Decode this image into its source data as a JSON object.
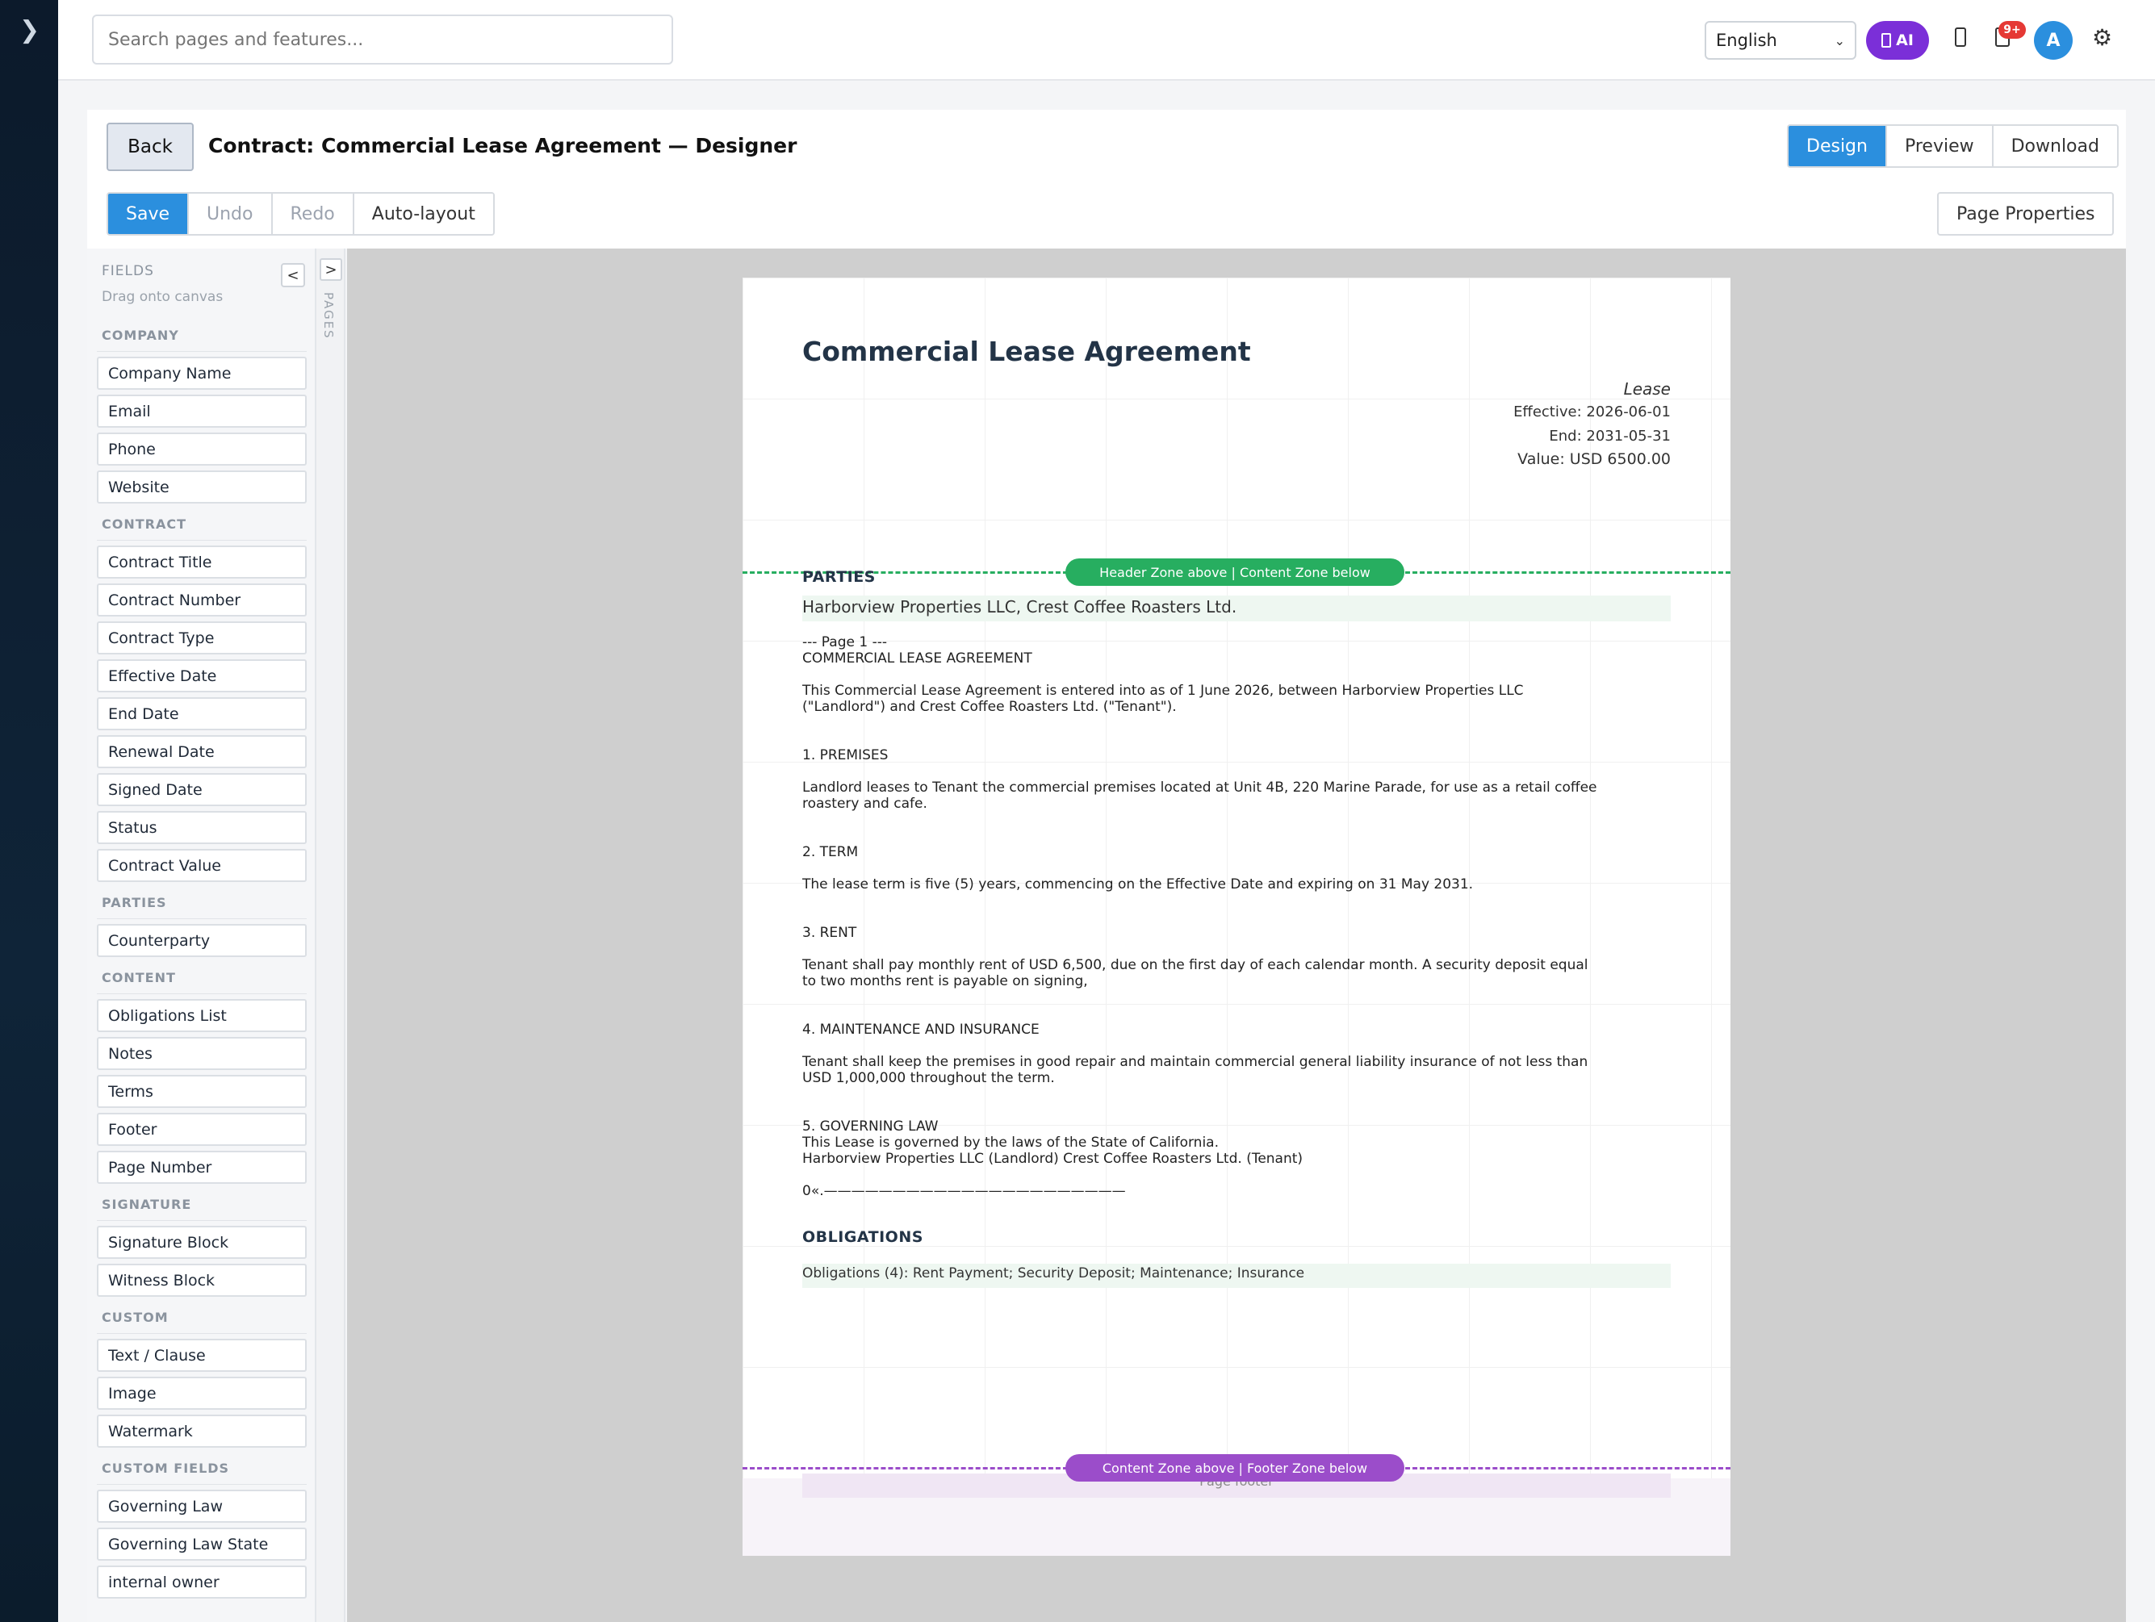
{
  "sidebar_toggle": "❯",
  "topbar": {
    "search_placeholder": "Search pages and features...",
    "language": "English",
    "ai_label": "AI",
    "notifications_badge": "9+",
    "avatar_initial": "A"
  },
  "header": {
    "back_label": "Back",
    "title": "Contract: Commercial Lease Agreement — Designer",
    "modes": [
      "Design",
      "Preview",
      "Download"
    ],
    "active_mode": "Design",
    "edit_actions": {
      "save": "Save",
      "undo": "Undo",
      "redo": "Redo",
      "auto_layout": "Auto-layout"
    },
    "page_properties": "Page Properties"
  },
  "fields_panel": {
    "heading": "FIELDS",
    "subheading": "Drag onto canvas",
    "collapse": "<",
    "groups": [
      {
        "name": "COMPANY",
        "items": [
          "Company Name",
          "Email",
          "Phone",
          "Website"
        ]
      },
      {
        "name": "CONTRACT",
        "items": [
          "Contract Title",
          "Contract Number",
          "Contract Type",
          "Effective Date",
          "End Date",
          "Renewal Date",
          "Signed Date",
          "Status",
          "Contract Value"
        ]
      },
      {
        "name": "PARTIES",
        "items": [
          "Counterparty"
        ]
      },
      {
        "name": "CONTENT",
        "items": [
          "Obligations List",
          "Notes",
          "Terms",
          "Footer",
          "Page Number"
        ]
      },
      {
        "name": "SIGNATURE",
        "items": [
          "Signature Block",
          "Witness Block"
        ]
      },
      {
        "name": "CUSTOM",
        "items": [
          "Text / Clause",
          "Image",
          "Watermark"
        ]
      },
      {
        "name": "CUSTOM FIELDS",
        "items": [
          "Governing Law",
          "Governing Law State",
          "internal owner"
        ]
      }
    ]
  },
  "pages_tab": {
    "toggle": ">",
    "label": "PAGES"
  },
  "document": {
    "title": "Commercial Lease Agreement",
    "type": "Lease",
    "effective": "Effective: 2026-06-01",
    "end": "End: 2031-05-31",
    "value": "Value: USD 6500.00",
    "header_zone_label": "Header Zone above | Content Zone below",
    "parties_heading": "PARTIES",
    "parties_value": "Harborview Properties LLC, Crest Coffee Roasters Ltd.",
    "body_lines": [
      "--- Page 1 ---",
      "COMMERCIAL LEASE AGREEMENT",
      "",
      "This Commercial Lease Agreement is entered into as of 1 June 2026, between Harborview Properties LLC",
      "(\"Landlord\") and Crest Coffee Roasters Ltd. (\"Tenant\").",
      "",
      "",
      "1. PREMISES",
      "",
      "Landlord leases to Tenant the commercial premises located at Unit 4B, 220 Marine Parade, for use as a retail coffee",
      "roastery and cafe.",
      "",
      "",
      "2. TERM",
      "",
      "The lease term is five (5) years, commencing on the Effective Date and expiring on 31 May 2031.",
      "",
      "",
      "3. RENT",
      "",
      "Tenant shall pay monthly rent of USD 6,500, due on the first day of each calendar month. A security deposit equal",
      "to two months rent is payable on signing,",
      "",
      "",
      "4. MAINTENANCE AND INSURANCE",
      "",
      "Tenant shall keep the premises in good repair and maintain commercial general liability insurance of not less than",
      "USD 1,000,000 throughout the term.",
      "",
      "",
      "5. GOVERNING LAW",
      "This Lease is governed by the laws of the State of California.",
      "Harborview Properties LLC (Landlord) Crest Coffee Roasters Ltd. (Tenant)",
      "",
      "0«.——————————————————————"
    ],
    "obligations_heading": "OBLIGATIONS",
    "obligations_value": "Obligations (4): Rent Payment; Security Deposit; Maintenance; Insurance",
    "footer_zone_label": "Content Zone above | Footer Zone below",
    "footer_placeholder": "Page footer"
  },
  "colors": {
    "accent": "#2b8fde",
    "ai": "#7b2fd8",
    "header_zone": "#27ae60",
    "footer_zone": "#9b4dca"
  }
}
